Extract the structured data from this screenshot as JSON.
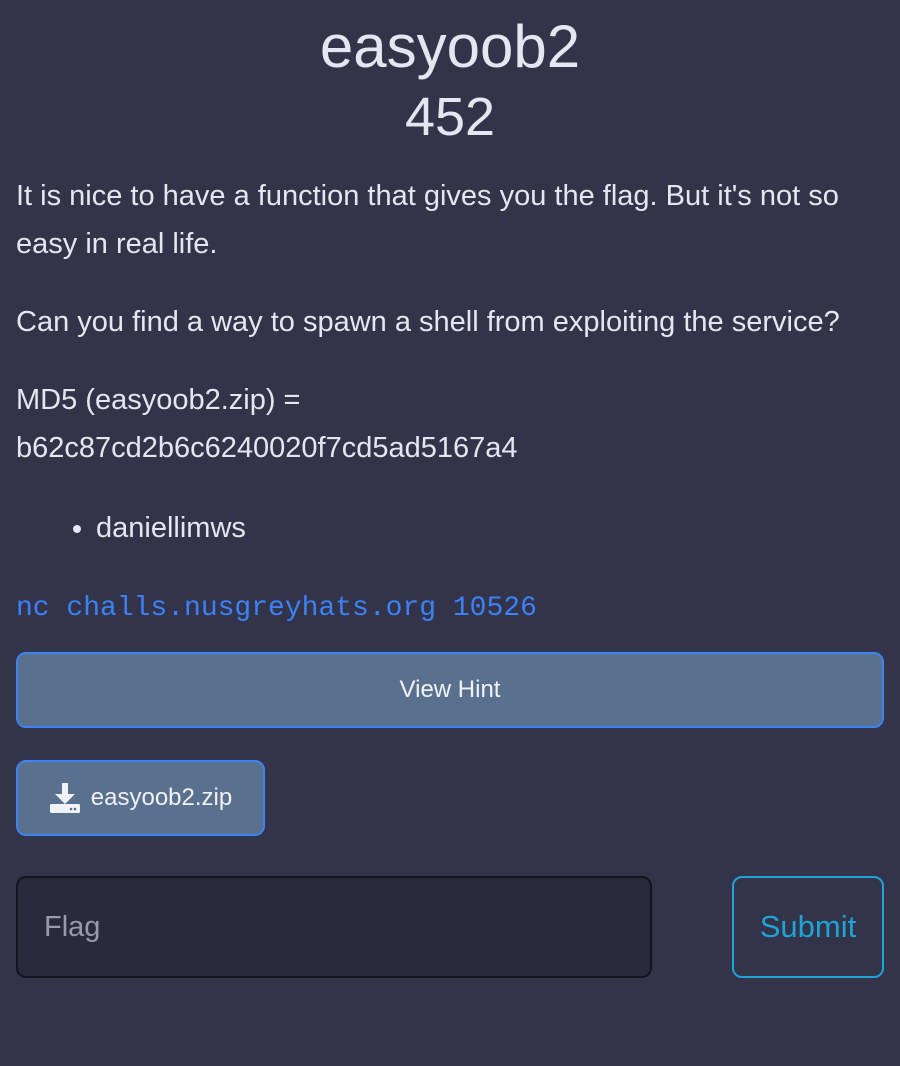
{
  "challenge": {
    "name": "easyoob2",
    "points": "452"
  },
  "description": {
    "paragraph_1": "It is nice to have a function that gives you the flag. But it's not so easy in real life.",
    "paragraph_2": "Can you find a way to spawn a shell from exploiting the service?",
    "md5_line_1": "MD5 (easyoob2.zip) =",
    "md5_line_2": "b62c87cd2b6c6240020f7cd5ad5167a4"
  },
  "authors": [
    "daniellimws"
  ],
  "connection": "nc challs.nusgreyhats.org 10526",
  "buttons": {
    "hint_label": "View Hint",
    "file_label": "easyoob2.zip",
    "file_icon": "download-icon",
    "submit_label": "Submit"
  },
  "flag_input": {
    "value": "",
    "placeholder": "Flag"
  },
  "colors": {
    "background": "#33334a",
    "link": "#3b82f6",
    "button_fill": "#5a708f",
    "button_border": "#3d84f0",
    "submit": "#1ea3d6"
  }
}
